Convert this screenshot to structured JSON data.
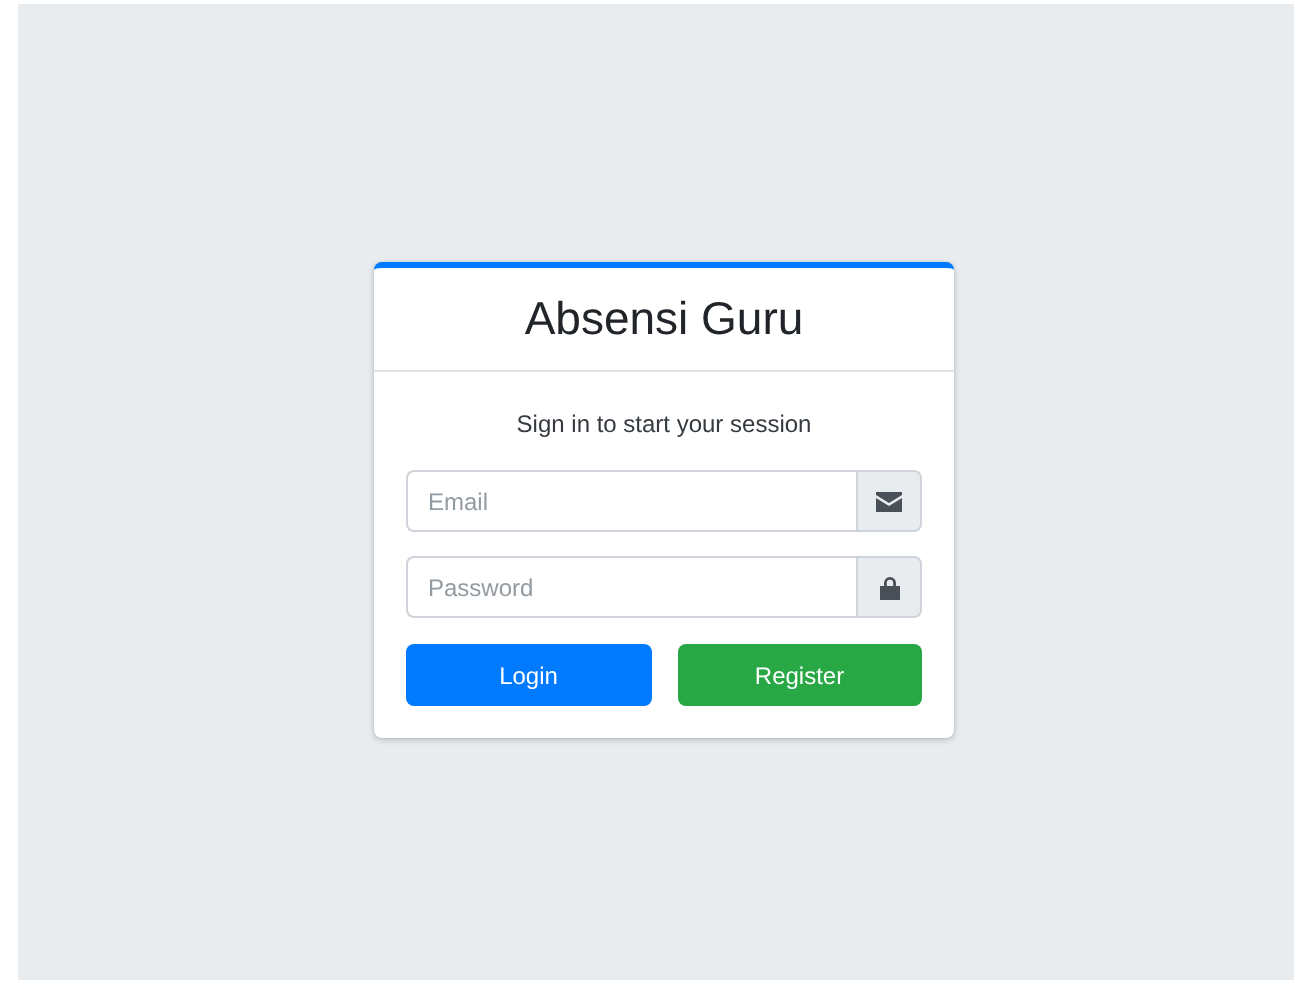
{
  "card": {
    "title": "Absensi Guru",
    "subtitle": "Sign in to start your session",
    "fields": [
      {
        "kind": "email",
        "placeholder": "Email"
      },
      {
        "kind": "password",
        "placeholder": "Password"
      }
    ],
    "buttons": [
      {
        "kind": "primary",
        "label": "Login"
      },
      {
        "kind": "success",
        "label": "Register"
      }
    ]
  }
}
